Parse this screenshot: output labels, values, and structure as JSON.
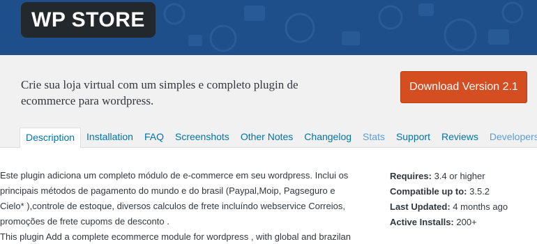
{
  "banner": {
    "logo_text": "WP STORE"
  },
  "header": {
    "tagline": "Crie sua loja virtual com um simples e completo plugin de ecommerce para wordpress.",
    "download_label": "Download Version 2.1"
  },
  "tabs": [
    {
      "label": "Description",
      "active": true
    },
    {
      "label": "Installation"
    },
    {
      "label": "FAQ"
    },
    {
      "label": "Screenshots"
    },
    {
      "label": "Other Notes"
    },
    {
      "label": "Changelog"
    },
    {
      "label": "Stats"
    },
    {
      "label": "Support"
    },
    {
      "label": "Reviews"
    },
    {
      "label": "Developers"
    }
  ],
  "description": {
    "lines": [
      "Este plugin adiciona um completo módulo de e-commerce em seu wordpress. Inclui os",
      "principais métodos de pagamento do mundo e do brasil (Paypal,Moip, Pagseguro e",
      "Cielo* ),controle de estoque, diversos calculos de frete incluíndo webservice Correios,",
      "promoções de frete cupoms de desconto .",
      "This plugin Add a complete ecommerce module for wordpress , with global and brazilan"
    ]
  },
  "meta": [
    {
      "label": "Requires:",
      "value": "3.4 or higher"
    },
    {
      "label": "Compatible up to:",
      "value": "3.5.2"
    },
    {
      "label": "Last Updated:",
      "value": "4 months ago"
    },
    {
      "label": "Active Installs:",
      "value": "200+"
    }
  ],
  "colors": {
    "banner": "#1f4f8a",
    "button": "#d54e21",
    "link": "#0073aa"
  }
}
